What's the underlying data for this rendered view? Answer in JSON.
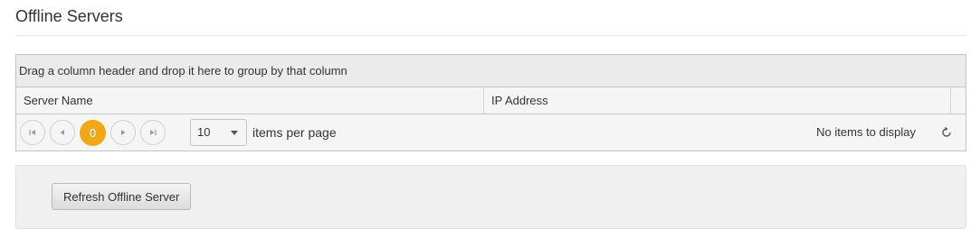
{
  "page": {
    "title": "Offline Servers"
  },
  "grid": {
    "group_hint": "Drag a column header and drop it here to group by that column",
    "columns": [
      "Server Name",
      "IP Address"
    ],
    "pager": {
      "current_page": "0",
      "page_size": "10",
      "per_page_label": "items per page",
      "status": "No items to display"
    }
  },
  "actions": {
    "refresh_label": "Refresh Offline Server"
  },
  "colors": {
    "accent": "#f0a818",
    "panel": "#f0f0f0",
    "border": "#c5c5c5"
  },
  "icons": {
    "first": "first-page-icon",
    "prev": "previous-page-icon",
    "next": "next-page-icon",
    "last": "last-page-icon",
    "refresh": "refresh-icon",
    "dropdown": "chevron-down-icon"
  }
}
